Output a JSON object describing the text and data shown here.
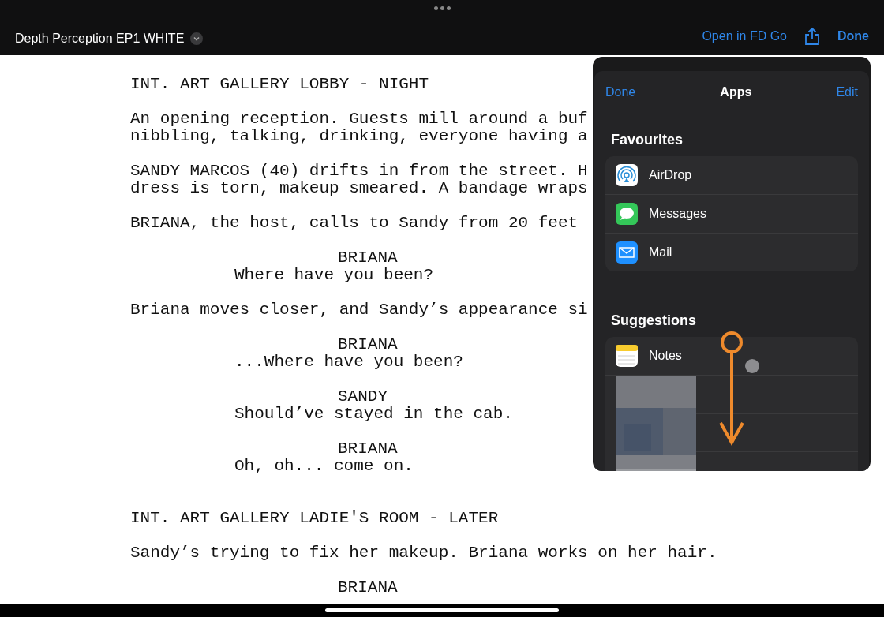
{
  "top_bar": {
    "title": "Depth Perception EP1 WHITE",
    "open_link": "Open in FD Go",
    "done": "Done"
  },
  "script": [
    {
      "kind": "scene",
      "lines": [
        "INT. ART GALLERY LOBBY - NIGHT"
      ]
    },
    {
      "kind": "action",
      "lines": [
        "An opening reception. Guests mill around a buf",
        "nibbling, talking, drinking, everyone having a"
      ]
    },
    {
      "kind": "action",
      "lines": [
        "SANDY MARCOS (40) drifts in from the street. H",
        "dress is torn, makeup smeared. A bandage wraps"
      ]
    },
    {
      "kind": "action",
      "lines": [
        "BRIANA, the host, calls to Sandy from 20 feet"
      ]
    },
    {
      "kind": "character",
      "lines": [
        "BRIANA"
      ]
    },
    {
      "kind": "dialogue",
      "lines": [
        "Where have you been?"
      ]
    },
    {
      "kind": "action",
      "lines": [
        "Briana moves closer, and Sandy’s appearance si"
      ]
    },
    {
      "kind": "character",
      "lines": [
        "BRIANA"
      ]
    },
    {
      "kind": "dialogue",
      "lines": [
        "...Where have you been?"
      ]
    },
    {
      "kind": "character",
      "lines": [
        "SANDY"
      ]
    },
    {
      "kind": "dialogue",
      "lines": [
        "Should’ve stayed in the cab."
      ]
    },
    {
      "kind": "character",
      "lines": [
        "BRIANA"
      ]
    },
    {
      "kind": "dialogue",
      "lines": [
        "Oh, oh... come on."
      ]
    },
    {
      "kind": "scene",
      "lines": [
        "INT. ART GALLERY LADIE'S ROOM - LATER"
      ]
    },
    {
      "kind": "action",
      "lines": [
        "Sandy’s trying to fix her makeup. Briana works on her hair."
      ]
    },
    {
      "kind": "character",
      "lines": [
        "BRIANA"
      ]
    }
  ],
  "share_sheet": {
    "done": "Done",
    "title": "Apps",
    "edit": "Edit",
    "sections": [
      {
        "heading": "Favourites",
        "items": [
          {
            "label": "AirDrop",
            "kind": "airdrop"
          },
          {
            "label": "Messages",
            "kind": "messages"
          },
          {
            "label": "Mail",
            "kind": "mail"
          }
        ]
      },
      {
        "heading": "Suggestions",
        "items": [
          {
            "label": "Notes",
            "kind": "notes"
          },
          {
            "kind": "picture"
          }
        ]
      }
    ]
  }
}
